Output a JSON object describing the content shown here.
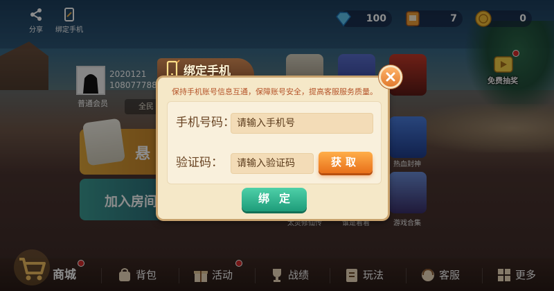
{
  "topbar": {
    "share_label": "分享",
    "bind_phone_label": "绑定手机",
    "diamond_count": "100",
    "card_count": "7",
    "gold_count": "0"
  },
  "profile": {
    "id_line1": "2020121",
    "id_line2": "1080777884",
    "member_label": "普通会员",
    "region_label": "全民"
  },
  "cards": {
    "create_partial": "悬",
    "join_label": "加入房间"
  },
  "bonus_label": "免费抽奖",
  "game_labels": [
    "太灵修仙传",
    "谁是着着",
    "游戏合集",
    "热血封神"
  ],
  "nav": {
    "items": [
      {
        "label": "商城",
        "icon": "cart-icon"
      },
      {
        "label": "背包",
        "icon": "bag-icon"
      },
      {
        "label": "活动",
        "icon": "gift-icon"
      },
      {
        "label": "战绩",
        "icon": "trophy-icon"
      },
      {
        "label": "玩法",
        "icon": "rules-icon"
      },
      {
        "label": "客服",
        "icon": "support-icon"
      },
      {
        "label": "更多",
        "icon": "more-icon"
      }
    ]
  },
  "dialog": {
    "title": "绑定手机",
    "note": "保持手机账号信息互通，保障账号安全，提高客服服务质量。",
    "phone_label": "手机号码：",
    "phone_placeholder": "请输入手机号",
    "code_label": "验证码：",
    "code_placeholder": "请输入验证码",
    "get_button": "获取",
    "bind_button": "绑定"
  },
  "colors": {
    "accent_orange": "#e8701a",
    "accent_green": "#1e9c7a",
    "panel_bg": "#f5e8c8",
    "note_text": "#b5542a"
  }
}
